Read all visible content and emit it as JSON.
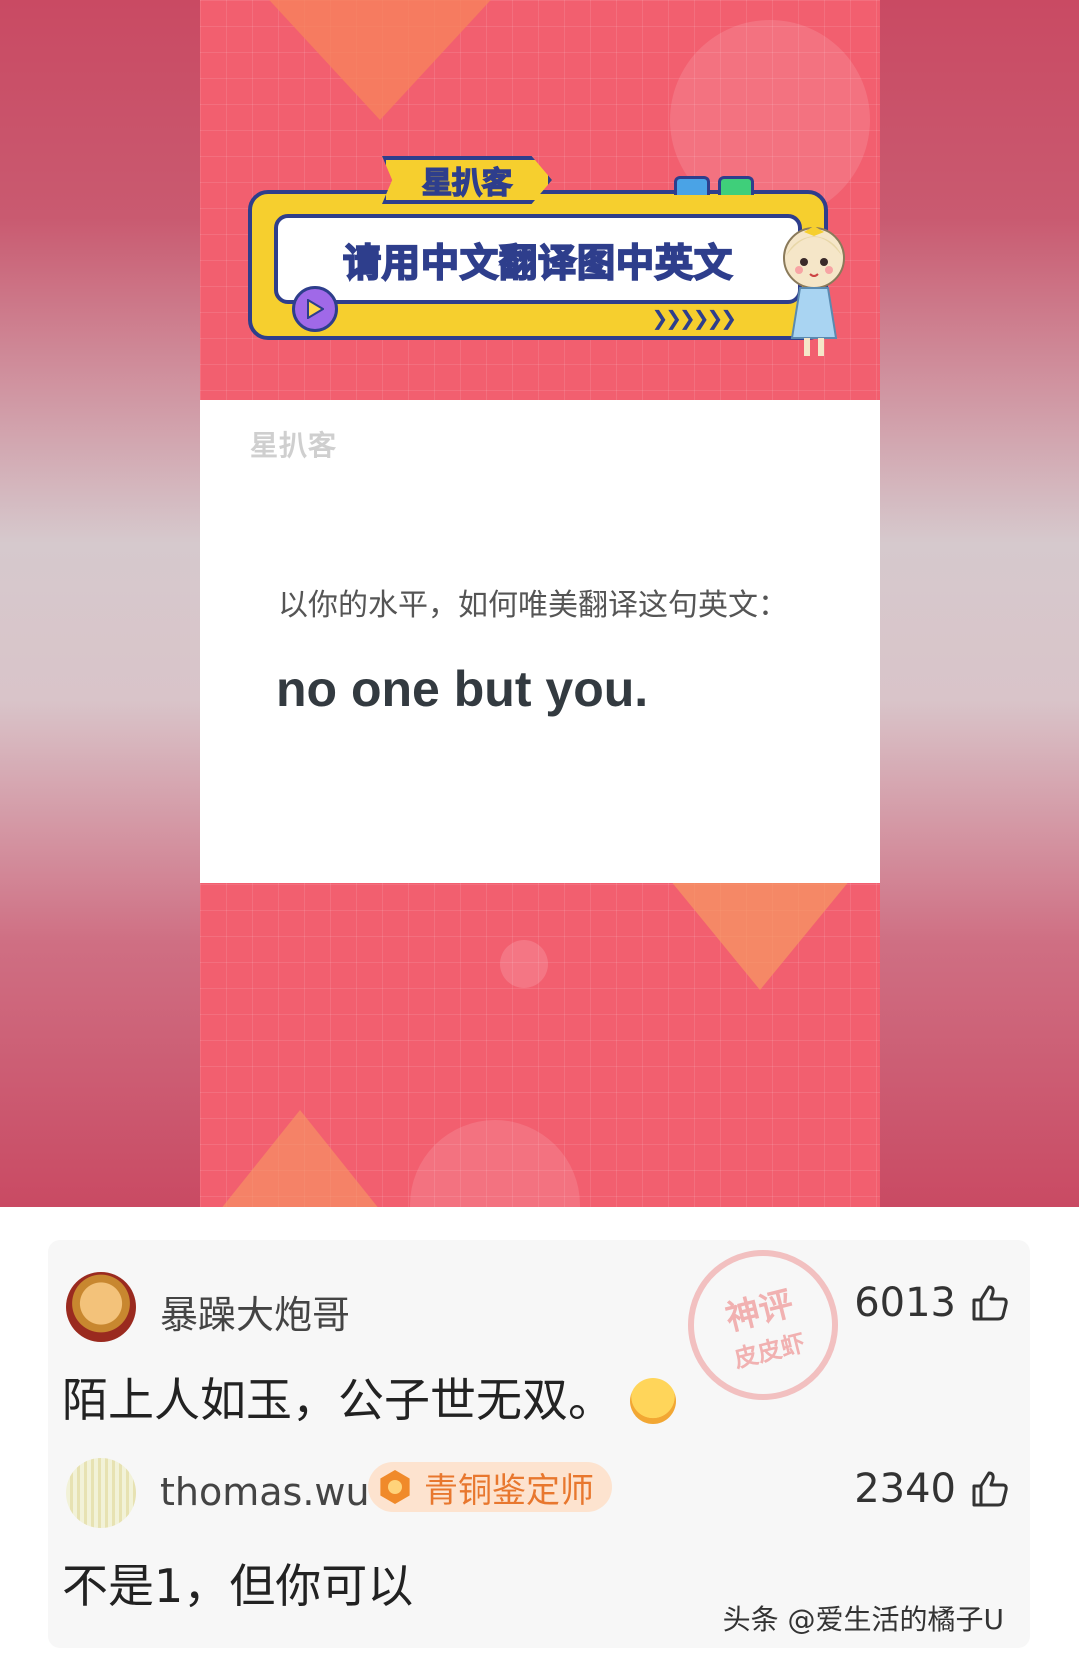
{
  "poster": {
    "tag_logo": "星扒客",
    "title": "请用中文翻译图中英文",
    "card_logo": "星扒客",
    "question": "以你的水平，如何唯美翻译这句英文：",
    "english_text": "no one but you."
  },
  "comments": [
    {
      "username": "暴躁大炮哥",
      "likes": "6013",
      "text": "陌上人如玉，公子世无双。",
      "stamp_top": "神评",
      "stamp_bottom": "皮皮虾"
    },
    {
      "username": "thomas.wu",
      "badge": "青铜鉴定师",
      "likes": "2340",
      "text": "不是1，但你可以"
    }
  ],
  "watermark": "头条 @爱生活的橘子U",
  "colors": {
    "poster_bg": "#f25f6f",
    "banner_yellow": "#f6cf2e",
    "banner_navy": "#2e3e8c",
    "badge_orange": "#e8772e"
  },
  "icons": [
    "play-icon",
    "thumb-up-icon",
    "badge-icon",
    "emoji-icon"
  ]
}
